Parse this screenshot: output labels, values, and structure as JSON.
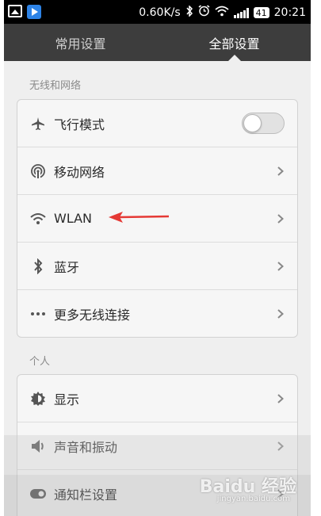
{
  "status_bar": {
    "speed": "0.60K/s",
    "battery": "41",
    "time": "20:21",
    "icons": [
      "picture-icon",
      "video-app-icon",
      "bluetooth-icon",
      "alarm-icon",
      "wifi-icon",
      "signal-icon",
      "battery-icon"
    ]
  },
  "tabs": {
    "left": "常用设置",
    "right": "全部设置",
    "active": "right"
  },
  "sections": {
    "wireless": {
      "title": "无线和网络",
      "items": [
        {
          "label": "飞行模式",
          "icon": "airplane-icon",
          "control": "toggle",
          "toggle_on": false
        },
        {
          "label": "移动网络",
          "icon": "mobile-network-icon",
          "control": "chevron"
        },
        {
          "label": "WLAN",
          "icon": "wifi-icon",
          "control": "chevron"
        },
        {
          "label": "蓝牙",
          "icon": "bluetooth-icon",
          "control": "chevron"
        },
        {
          "label": "更多无线连接",
          "icon": "more-dots-icon",
          "control": "chevron"
        }
      ]
    },
    "personal": {
      "title": "个人",
      "items": [
        {
          "label": "显示",
          "icon": "display-gear-icon",
          "control": "chevron"
        },
        {
          "label": "声音和振动",
          "icon": "speaker-icon",
          "control": "chevron"
        },
        {
          "label": "通知栏设置",
          "icon": "notification-toggle-icon",
          "control": "chevron"
        }
      ]
    }
  },
  "watermark": {
    "text": "Baidu 经验",
    "sub": "jingyan.baidu.com"
  },
  "colors": {
    "tab_bar": "#3d3d3d",
    "status_bar": "#000000",
    "annotation_arrow": "#e53935",
    "background": "#efefef"
  }
}
